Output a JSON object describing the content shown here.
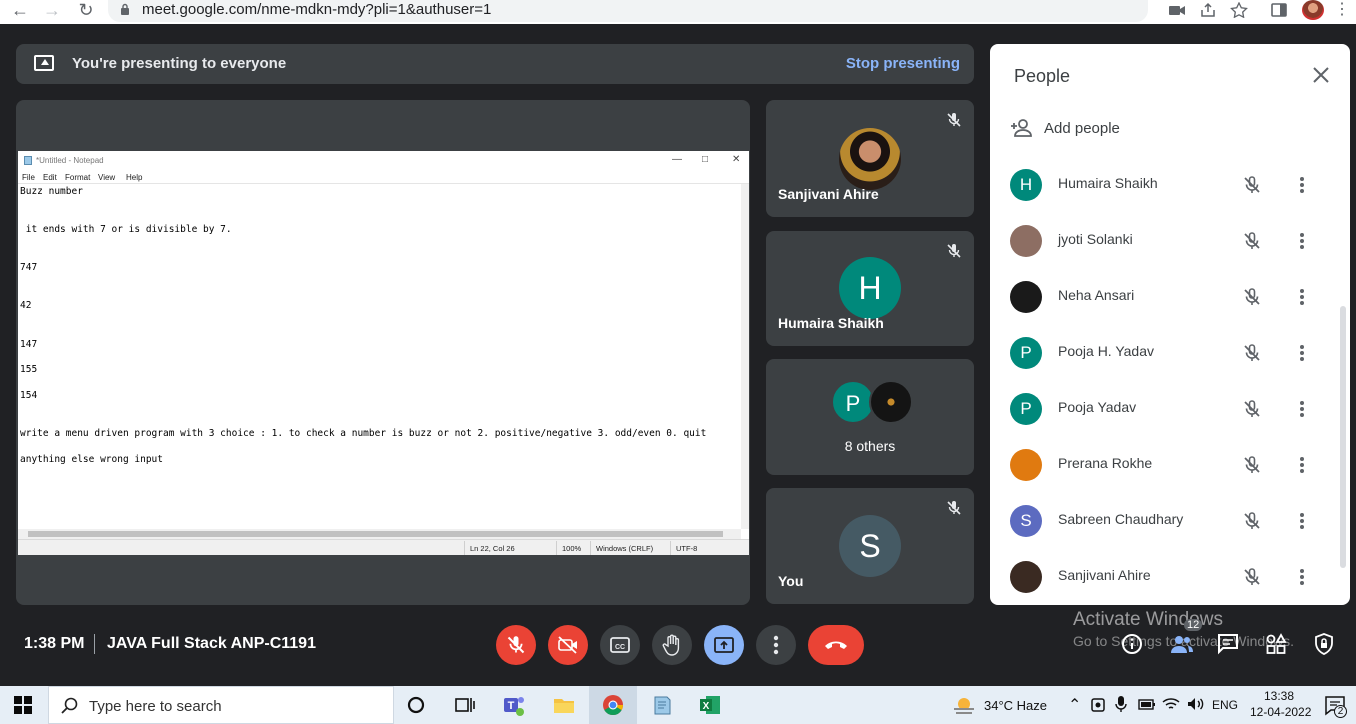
{
  "browser": {
    "url": "meet.google.com/nme-mdkn-mdy?pli=1&authuser=1"
  },
  "banner": {
    "text": "You're presenting to everyone",
    "stop_label": "Stop presenting"
  },
  "notepad": {
    "title": "*Untitled - Notepad",
    "menu": [
      "File",
      "Edit",
      "Format",
      "View",
      "Help"
    ],
    "lines": [
      "Buzz number",
      " it ends with 7 or is divisible by 7.",
      "747",
      "42",
      "147",
      "155",
      "154",
      "write a menu driven program with 3 choice : 1. to check a number is buzz or not 2. positive/negative 3. odd/even 0. quit",
      "anything else wrong input"
    ],
    "status": {
      "position": "Ln 22, Col 26",
      "zoom": "100%",
      "line_ending": "Windows (CRLF)",
      "encoding": "UTF-8"
    }
  },
  "tiles": [
    {
      "name": "Sanjivani Ahire"
    },
    {
      "name": "Humaira Shaikh",
      "initial": "H",
      "color": "#00897b"
    },
    {
      "name": "8 others",
      "initial": "P",
      "color": "#00897b"
    },
    {
      "name": "You",
      "initial": "S",
      "color": "#455a64"
    }
  ],
  "bottom": {
    "time": "1:38 PM",
    "meeting": "JAVA Full Stack ANP-C1191",
    "people_count": "12"
  },
  "people": {
    "title": "People",
    "add_label": "Add people",
    "list": [
      {
        "name": "Humaira Shaikh",
        "initial": "H",
        "color": "#00897b"
      },
      {
        "name": "jyoti Solanki",
        "initial": "",
        "color": "#8d6e63"
      },
      {
        "name": "Neha Ansari",
        "initial": "",
        "color": "#1a1a1a"
      },
      {
        "name": "Pooja H. Yadav",
        "initial": "P",
        "color": "#00897b"
      },
      {
        "name": "Pooja Yadav",
        "initial": "P",
        "color": "#00897b"
      },
      {
        "name": "Prerana Rokhe",
        "initial": "",
        "color": "#e07a10"
      },
      {
        "name": "Sabreen Chaudhary",
        "initial": "S",
        "color": "#5c6bc0"
      },
      {
        "name": "Sanjivani Ahire",
        "initial": "",
        "color": "#3a2a22"
      }
    ]
  },
  "watermark": {
    "line1": "Activate Windows",
    "line2": "Go to Settings to activate Windows."
  },
  "taskbar": {
    "search_placeholder": "Type here to search",
    "weather": "34°C  Haze",
    "lang": "ENG",
    "time": "13:38",
    "date": "12-04-2022",
    "notifications": "2"
  }
}
